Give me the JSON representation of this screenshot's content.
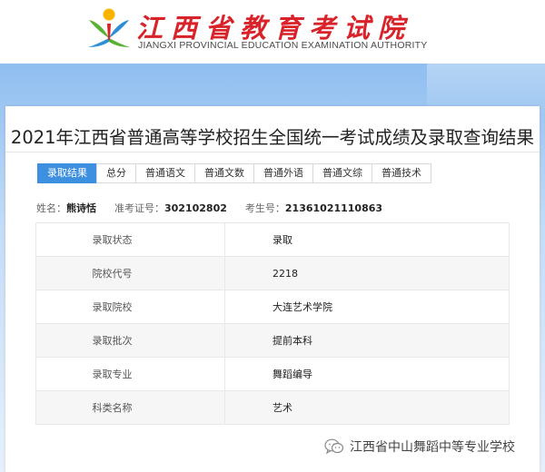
{
  "header": {
    "site_name": "江西省教育考试院",
    "site_name_en": "JIANGXI PROVINCIAL EDUCATION EXAMINATION AUTHORITY"
  },
  "page": {
    "title": "2021年江西省普通高等学校招生全国统一考试成绩及录取查询结果"
  },
  "tabs": [
    {
      "label": "录取结果",
      "active": true
    },
    {
      "label": "总分",
      "active": false
    },
    {
      "label": "普通语文",
      "active": false
    },
    {
      "label": "普通文数",
      "active": false
    },
    {
      "label": "普通外语",
      "active": false
    },
    {
      "label": "普通文综",
      "active": false
    },
    {
      "label": "普通技术",
      "active": false
    }
  ],
  "candidate": {
    "name_label": "姓名：",
    "name": "熊诗恬",
    "admission_no_label": "准考证号：",
    "admission_no": "302102802",
    "exam_no_label": "考生号：",
    "exam_no": "21361021110863"
  },
  "result_rows": [
    {
      "key": "录取状态",
      "value": "录取"
    },
    {
      "key": "院校代号",
      "value": "2218"
    },
    {
      "key": "录取院校",
      "value": "大连艺术学院"
    },
    {
      "key": "录取批次",
      "value": "提前本科"
    },
    {
      "key": "录取专业",
      "value": "舞蹈编导"
    },
    {
      "key": "科类名称",
      "value": "艺术"
    }
  ],
  "watermark": {
    "text": "江西省中山舞蹈中等专业学校",
    "icon": "wechat-icon"
  },
  "colors": {
    "brand_red": "#d8232a",
    "tab_active": "#3d8fe0",
    "band_blue": "#8fbef0"
  }
}
